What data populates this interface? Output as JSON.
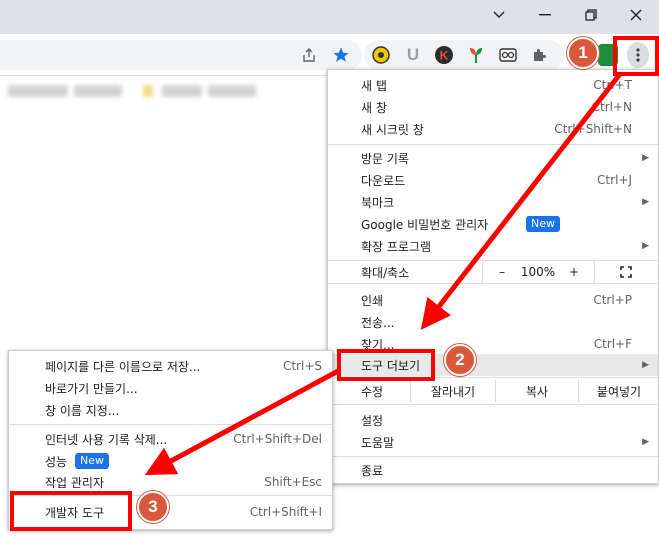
{
  "window": {
    "minimize_icon": "chevron-down-icon",
    "controls": [
      "minimize",
      "restore",
      "close"
    ]
  },
  "toolbar": {
    "extensions": [
      "share-icon",
      "star-icon",
      "extension-yellow-icon",
      "u-icon",
      "k-icon",
      "plant-icon",
      "reader-icon",
      "puzzle-icon"
    ]
  },
  "main_menu": {
    "new_tab": "새 탭",
    "new_tab_sc": "Ctrl+T",
    "new_window": "새 창",
    "new_window_sc": "Ctrl+N",
    "incognito": "새 시크릿 창",
    "incognito_sc": "Ctrl+Shift+N",
    "history": "방문 기록",
    "downloads": "다운로드",
    "downloads_sc": "Ctrl+J",
    "bookmarks": "북마크",
    "password_manager": "Google 비밀번호 관리자",
    "new_badge": "New",
    "extensions": "확장 프로그램",
    "zoom_label": "확대/축소",
    "zoom_minus": "–",
    "zoom_value": "100%",
    "zoom_plus": "+",
    "print": "인쇄",
    "print_sc": "Ctrl+P",
    "cast": "전송...",
    "find": "찾기...",
    "find_sc": "Ctrl+F",
    "more_tools": "도구 더보기",
    "edit": "수정",
    "cut": "잘라내기",
    "copy": "복사",
    "paste": "붙여넣기",
    "settings": "설정",
    "help": "도움말",
    "exit": "종료"
  },
  "sub_menu": {
    "save_page": "페이지를 다른 이름으로 저장...",
    "save_page_sc": "Ctrl+S",
    "create_shortcut": "바로가기 만들기...",
    "name_window": "창 이름 지정...",
    "clear_data": "인터넷 사용 기록 삭제...",
    "clear_data_sc": "Ctrl+Shift+Del",
    "performance": "성능",
    "new_badge": "New",
    "task_manager": "작업 관리자",
    "task_manager_sc": "Shift+Esc",
    "dev_tools": "개발자 도구",
    "dev_tools_sc": "Ctrl+Shift+I"
  },
  "annotations": {
    "step1": "1",
    "step2": "2",
    "step3": "3",
    "color": "#ff0000",
    "circle_color": "#d9573a"
  }
}
